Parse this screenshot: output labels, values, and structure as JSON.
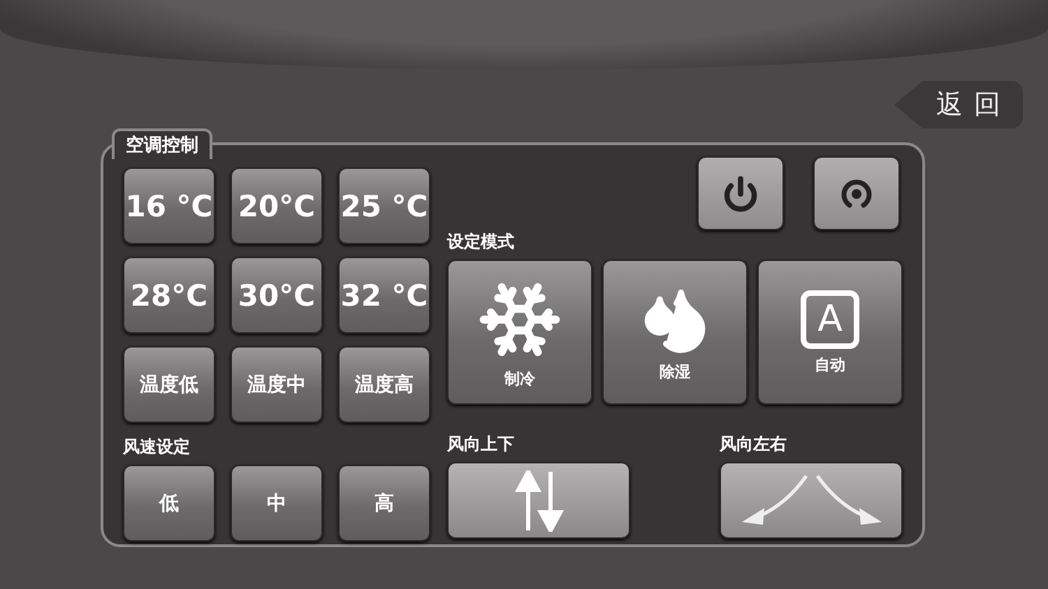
{
  "back_button": {
    "label": "返回"
  },
  "panel": {
    "title": "空调控制"
  },
  "top_buttons": [
    {
      "kind": "power"
    },
    {
      "kind": "ring"
    }
  ],
  "temperature_buttons": [
    {
      "label": "16 °C"
    },
    {
      "label": "20°C"
    },
    {
      "label": "25 °C"
    },
    {
      "label": "28°C"
    },
    {
      "label": "30°C"
    },
    {
      "label": "32 °C"
    },
    {
      "label": "温度低"
    },
    {
      "label": "温度中"
    },
    {
      "label": "温度高"
    }
  ],
  "mode_section": {
    "title": "设定模式",
    "modes": [
      {
        "kind": "cool",
        "label": "制冷"
      },
      {
        "kind": "dry",
        "label": "除湿"
      },
      {
        "kind": "auto",
        "label": "自动",
        "icon_text": "A"
      }
    ]
  },
  "fan_speed": {
    "title": "风速设定",
    "buttons": [
      {
        "label": "低"
      },
      {
        "label": "中"
      },
      {
        "label": "高"
      }
    ]
  },
  "swing": [
    {
      "kind": "vertical",
      "title": "风向上下"
    },
    {
      "kind": "horizontal",
      "title": "风向左右"
    }
  ]
}
